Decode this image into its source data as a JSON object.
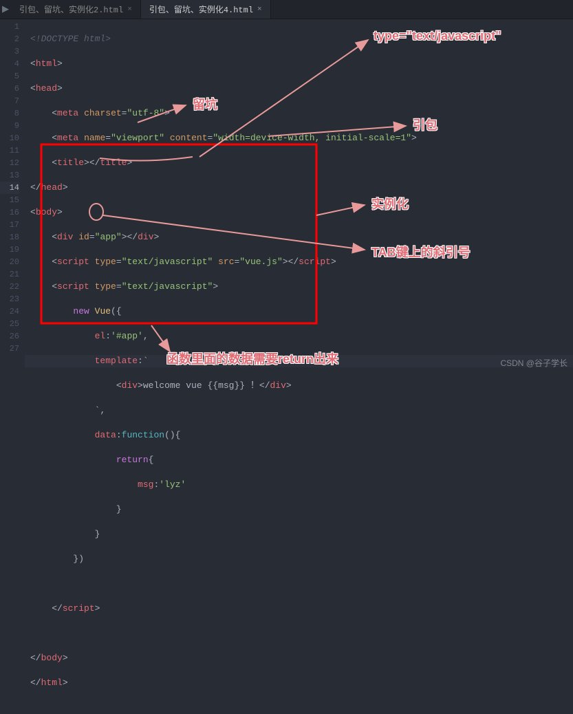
{
  "tabs": [
    {
      "label": "引包、留坑、实例化2.html"
    },
    {
      "label": "引包、留坑、实例化4.html"
    }
  ],
  "gutter": {
    "lines": [
      "1",
      "2",
      "3",
      "4",
      "5",
      "6",
      "7",
      "8",
      "9",
      "10",
      "11",
      "12",
      "13",
      "14",
      "15",
      "16",
      "17",
      "18",
      "19",
      "20",
      "21",
      "22",
      "23",
      "24",
      "25",
      "26",
      "27"
    ],
    "folds": [
      3,
      8,
      11,
      12,
      17
    ],
    "highlight": 14
  },
  "code": {
    "l1": "<!DOCTYPE html>",
    "l2_open": "<",
    "l2_tag": "html",
    "l2_close": ">",
    "l3_tag": "head",
    "l4_tag": "meta",
    "l4_attr": "charset",
    "l4_val": "\"utf-8\"",
    "l5_tag": "meta",
    "l5_attr1": "name",
    "l5_val1": "\"viewport\"",
    "l5_attr2": "content",
    "l5_val2": "\"width=device-width, initial-scale=1\"",
    "l6_tag": "title",
    "l7_tag": "head",
    "l8_tag": "body",
    "l9_tag": "div",
    "l9_attr": "id",
    "l9_val": "\"app\"",
    "l10_tag": "script",
    "l10_attr1": "type",
    "l10_val1": "\"text/javascript\"",
    "l10_attr2": "src",
    "l10_val2": "\"vue.js\"",
    "l11_tag": "script",
    "l11_attr": "type",
    "l11_val": "\"text/javascript\"",
    "l12_kw": "new",
    "l12_ident": "Vue",
    "l13_prop": "el",
    "l13_val": "'#app'",
    "l14_prop": "template",
    "l14_tick": "`",
    "l15_tag": "div",
    "l15_text": "welcome vue {{msg}} ！",
    "l16_tick": "`",
    "l17_prop": "data",
    "l17_fn": "function",
    "l18_kw": "return",
    "l19_prop": "msg",
    "l19_val": "'lyz'",
    "l24_tag": "script",
    "l26_tag": "body",
    "l27_tag": "html"
  },
  "annotations": {
    "type_label": "type=\"text/javascript\"",
    "liukeng": "留坑",
    "yinbao": "引包",
    "shilihua": "实例化",
    "tab_backtick": "TAB键上的斜引号",
    "return_note": "函数里面的数据需要return出来"
  },
  "watermark": "CSDN @谷子学长"
}
